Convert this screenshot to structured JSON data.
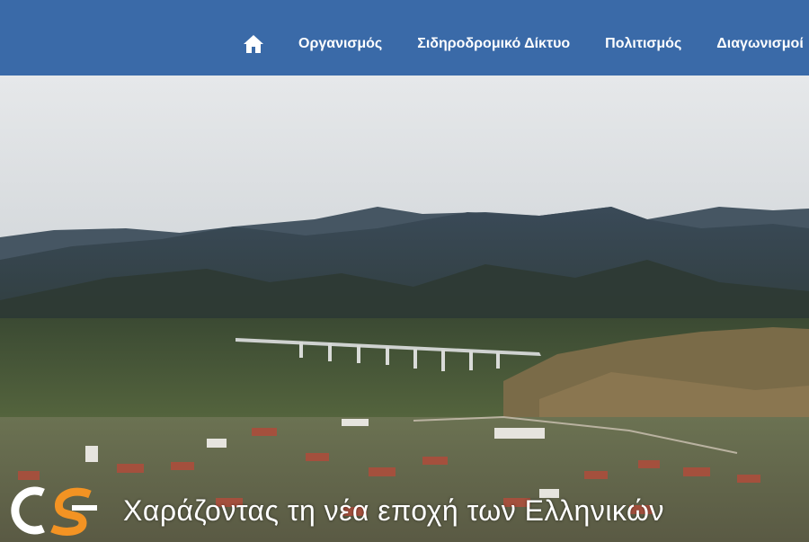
{
  "nav": {
    "home_icon": "home-icon",
    "items": [
      {
        "label": "Οργανισμός"
      },
      {
        "label": "Σιδηροδρομικό Δίκτυο"
      },
      {
        "label": "Πολιτισμός"
      },
      {
        "label": "Διαγωνισμοί"
      }
    ]
  },
  "hero": {
    "tagline": "Χαράζοντας τη νέα εποχή των Ελληνικών",
    "logo_icon": "ose-logo"
  },
  "colors": {
    "nav_bg": "#3a6aa8",
    "logo_orange": "#f39323"
  }
}
